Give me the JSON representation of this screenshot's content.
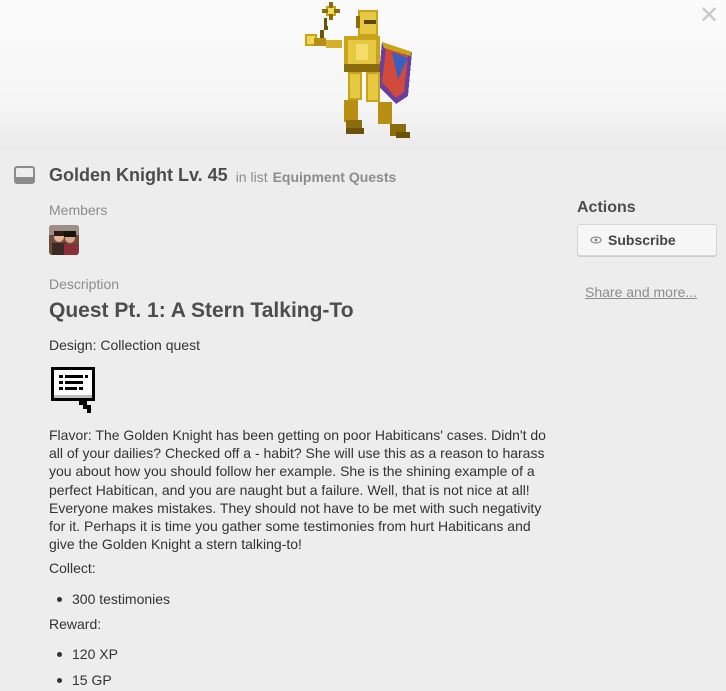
{
  "window": {
    "close_label": "✕"
  },
  "card": {
    "title": "Golden Knight Lv. 45",
    "in_list_prefix": "in list",
    "list_name": "Equipment Quests"
  },
  "members": {
    "label": "Members"
  },
  "description": {
    "label": "Description",
    "quest_title": "Quest Pt. 1: A Stern Talking-To",
    "design": "Design: Collection quest",
    "flavor": "Flavor: The Golden Knight has been getting on poor Habiticans' cases. Didn't do all of your dailies? Checked off a - habit? She will use this as a reason to harass you about how you should follow her example. She is the shining example of a perfect Habitican, and you are naught but a failure. Well, that is not nice at all! Everyone makes mistakes. They should not have to be met with such negativity for it. Perhaps it is time you gather some testimonies from hurt Habiticans and give the Golden Knight a stern talking-to!",
    "collect_label": "Collect:",
    "collect_items": [
      "300 testimonies"
    ],
    "reward_label": "Reward:",
    "reward_items": [
      "120 XP",
      "15 GP"
    ]
  },
  "actions": {
    "title": "Actions",
    "subscribe_label": "Subscribe",
    "share_label": "Share and more..."
  },
  "icons": {
    "close": "close-icon",
    "card": "card-icon",
    "subscribe": "eye-icon",
    "quest_scroll": "scroll-icon",
    "knight": "golden-knight-sprite"
  }
}
